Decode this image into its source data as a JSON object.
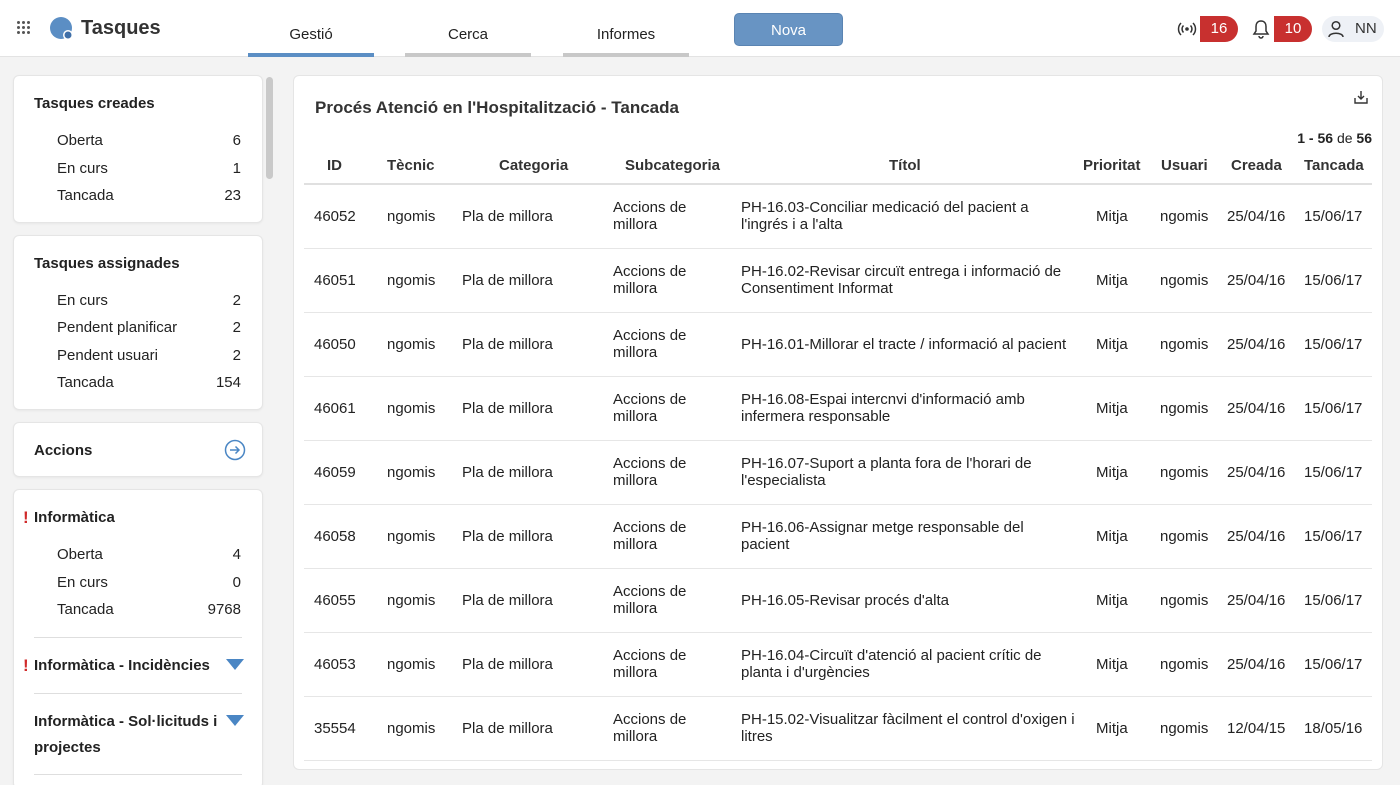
{
  "app": {
    "title": "Tasques"
  },
  "colors": {
    "accent": "#5b8ec4",
    "new_button": "#6894c3",
    "badge": "#c8302f",
    "warning": "#d02a2a"
  },
  "tabs": [
    {
      "label": "Gestió",
      "active": true
    },
    {
      "label": "Cerca",
      "active": false
    },
    {
      "label": "Informes",
      "active": false
    }
  ],
  "new_button": "Nova",
  "badges": {
    "signal_count": "16",
    "bell_count": "10"
  },
  "user": {
    "initials": "NN"
  },
  "sidebar": {
    "created": {
      "title": "Tasques creades",
      "items": [
        {
          "label": "Oberta",
          "count": "6"
        },
        {
          "label": "En curs",
          "count": "1"
        },
        {
          "label": "Tancada",
          "count": "23"
        }
      ]
    },
    "assigned": {
      "title": "Tasques assignades",
      "items": [
        {
          "label": "En curs",
          "count": "2"
        },
        {
          "label": "Pendent planificar",
          "count": "2"
        },
        {
          "label": "Pendent usuari",
          "count": "2"
        },
        {
          "label": "Tancada",
          "count": "154"
        }
      ]
    },
    "actions": {
      "title": "Accions"
    },
    "informatica": {
      "title": "Informàtica",
      "warning": "!",
      "items": [
        {
          "label": "Oberta",
          "count": "4"
        },
        {
          "label": "En curs",
          "count": "0"
        },
        {
          "label": "Tancada",
          "count": "9768"
        }
      ],
      "sub1": "Informàtica - Incidències",
      "sub2_line1": "Informàtica - Sol·licituds i",
      "sub2_line2": "projectes"
    }
  },
  "main": {
    "title": "Procés Atenció en l'Hospitalització - Tancada",
    "pager": {
      "from": "1",
      "sep": "-",
      "to": "56",
      "of": "de",
      "total": "56"
    },
    "columns": [
      "ID",
      "Tècnic",
      "Categoria",
      "Subcategoria",
      "Títol",
      "Prioritat",
      "Usuari",
      "Creada",
      "Tancada"
    ],
    "rows": [
      {
        "id": "46052",
        "tecnic": "ngomis",
        "categoria": "Pla de millora",
        "sub1": "Accions de",
        "sub2": "millora",
        "titol1": "PH-16.03-Conciliar medicació del pacient a",
        "titol2": "l'ingrés i a l'alta",
        "prioritat": "Mitja",
        "usuari": "ngomis",
        "creada": "25/04/16",
        "tancada": "15/06/17"
      },
      {
        "id": "46051",
        "tecnic": "ngomis",
        "categoria": "Pla de millora",
        "sub1": "Accions de",
        "sub2": "millora",
        "titol1": "PH-16.02-Revisar circuït entrega i informació de",
        "titol2": "Consentiment Informat",
        "prioritat": "Mitja",
        "usuari": "ngomis",
        "creada": "25/04/16",
        "tancada": "15/06/17"
      },
      {
        "id": "46050",
        "tecnic": "ngomis",
        "categoria": "Pla de millora",
        "sub1": "Accions de",
        "sub2": "millora",
        "titol1": "PH-16.01-Millorar el tracte / informació al pacient",
        "titol2": "",
        "prioritat": "Mitja",
        "usuari": "ngomis",
        "creada": "25/04/16",
        "tancada": "15/06/17"
      },
      {
        "id": "46061",
        "tecnic": "ngomis",
        "categoria": "Pla de millora",
        "sub1": "Accions de",
        "sub2": "millora",
        "titol1": "PH-16.08-Espai intercnvi d'informació amb",
        "titol2": "infermera responsable",
        "prioritat": "Mitja",
        "usuari": "ngomis",
        "creada": "25/04/16",
        "tancada": "15/06/17"
      },
      {
        "id": "46059",
        "tecnic": "ngomis",
        "categoria": "Pla de millora",
        "sub1": "Accions de",
        "sub2": "millora",
        "titol1": "PH-16.07-Suport a planta fora de l'horari de",
        "titol2": "l'especialista",
        "prioritat": "Mitja",
        "usuari": "ngomis",
        "creada": "25/04/16",
        "tancada": "15/06/17"
      },
      {
        "id": "46058",
        "tecnic": "ngomis",
        "categoria": "Pla de millora",
        "sub1": "Accions de",
        "sub2": "millora",
        "titol1": "PH-16.06-Assignar metge responsable del",
        "titol2": "pacient",
        "prioritat": "Mitja",
        "usuari": "ngomis",
        "creada": "25/04/16",
        "tancada": "15/06/17"
      },
      {
        "id": "46055",
        "tecnic": "ngomis",
        "categoria": "Pla de millora",
        "sub1": "Accions de",
        "sub2": "millora",
        "titol1": "PH-16.05-Revisar procés d'alta",
        "titol2": "",
        "prioritat": "Mitja",
        "usuari": "ngomis",
        "creada": "25/04/16",
        "tancada": "15/06/17"
      },
      {
        "id": "46053",
        "tecnic": "ngomis",
        "categoria": "Pla de millora",
        "sub1": "Accions de",
        "sub2": "millora",
        "titol1": "PH-16.04-Circuït d'atenció al pacient crític de",
        "titol2": "planta i d'urgències",
        "prioritat": "Mitja",
        "usuari": "ngomis",
        "creada": "25/04/16",
        "tancada": "15/06/17"
      },
      {
        "id": "35554",
        "tecnic": "ngomis",
        "categoria": "Pla de millora",
        "sub1": "Accions de",
        "sub2": "millora",
        "titol1": "PH-15.02-Visualitzar fàcilment el control d'oxigen i",
        "titol2": "litres",
        "prioritat": "Mitja",
        "usuari": "ngomis",
        "creada": "12/04/15",
        "tancada": "18/05/16"
      }
    ]
  }
}
